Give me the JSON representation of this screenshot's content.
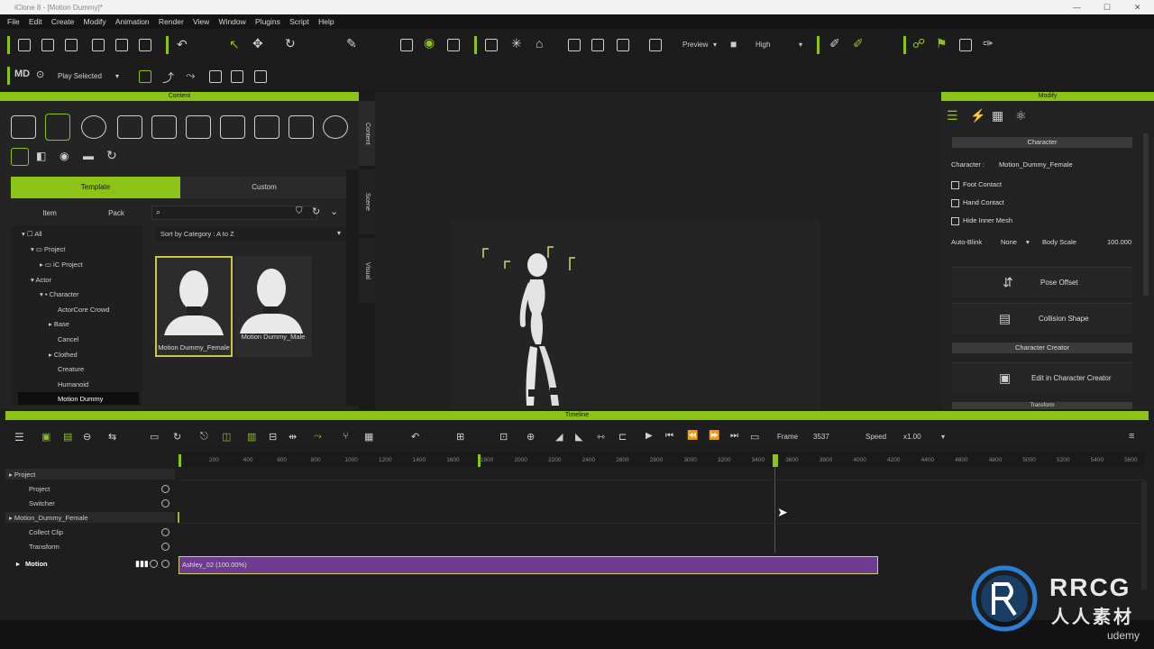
{
  "window": {
    "title": "iClone 8 - [Motion Dummy]*"
  },
  "menu": [
    "File",
    "Edit",
    "Create",
    "Modify",
    "Animation",
    "Render",
    "View",
    "Window",
    "Plugins",
    "Script",
    "Help"
  ],
  "toolbar": {
    "preview_label": "Preview",
    "quality_label": "High",
    "play_mode_label": "Play Selected"
  },
  "content_panel": {
    "title": "Content",
    "tabs": [
      "Template",
      "Custom"
    ],
    "subtabs": [
      "Item",
      "Pack"
    ],
    "side_tabs": [
      "Content",
      "Scene",
      "Visual"
    ],
    "sort_label": "Sort by Category : A to Z",
    "tree": [
      "All",
      "Project",
      "iC Project",
      "Actor",
      "Character",
      "ActorCore Crowd",
      "Base",
      "Cancel",
      "Clothed",
      "Creature",
      "Humanoid",
      "Motion Dummy"
    ],
    "thumbs": [
      {
        "label": "Motion Dummy_Female"
      },
      {
        "label": "Motion Dummy_Male"
      }
    ]
  },
  "modify_panel": {
    "title": "Modify",
    "section_character": "Character",
    "character_label": "Character :",
    "character_value": "Motion_Dummy_Female",
    "foot_contact": "Foot Contact",
    "hand_contact": "Hand Contact",
    "hide_inner_mesh": "Hide Inner Mesh",
    "auto_blink_label": "Auto-Blink",
    "auto_blink_value": "None",
    "body_scale_label": "Body Scale",
    "body_scale_value": "100.000",
    "pose_offset": "Pose Offset",
    "collision_shape": "Collision Shape",
    "section_cc": "Character Creator",
    "edit_in_cc": "Edit in Character Creator",
    "section_transform": "Transform"
  },
  "timeline": {
    "title": "Timeline",
    "frame_label": "Frame",
    "frame_value": "3537",
    "speed_label": "Speed",
    "speed_value": "x1.00",
    "ruler": [
      "200",
      "400",
      "600",
      "800",
      "1000",
      "1200",
      "1400",
      "1600",
      "1800",
      "2000",
      "2200",
      "2400",
      "2600",
      "2800",
      "3000",
      "3200",
      "3400",
      "3600",
      "3800",
      "4000",
      "4200",
      "4400",
      "4600",
      "4800",
      "5000",
      "5200",
      "5400",
      "5600"
    ],
    "tracks": [
      "Project",
      "Project",
      "Switcher",
      "Motion_Dummy_Female",
      "Collect Clip",
      "Transform",
      "Motion"
    ],
    "clip_label": "Ashley_02 (100.00%)"
  },
  "watermark": {
    "brand": "RRCG",
    "sub": "人人素材",
    "udemy": "udemy"
  },
  "colors": {
    "accent": "#8bc417",
    "clip": "#6e3b8e",
    "bg": "#1e1e1e"
  }
}
